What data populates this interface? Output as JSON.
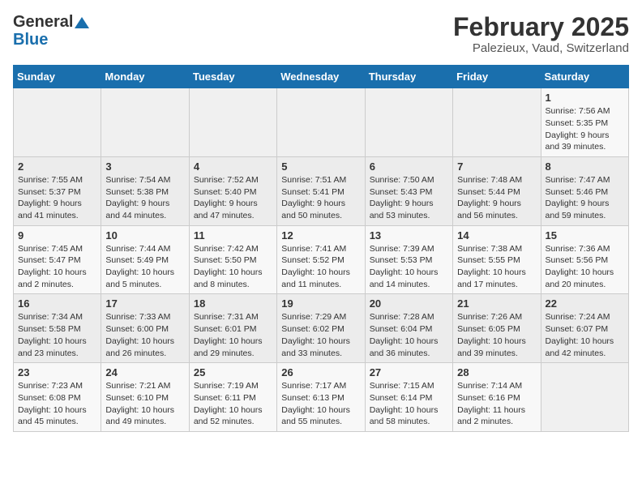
{
  "logo": {
    "line1": "General",
    "line2": "Blue"
  },
  "title": "February 2025",
  "location": "Palezieux, Vaud, Switzerland",
  "days_of_week": [
    "Sunday",
    "Monday",
    "Tuesday",
    "Wednesday",
    "Thursday",
    "Friday",
    "Saturday"
  ],
  "weeks": [
    [
      {
        "day": "",
        "info": ""
      },
      {
        "day": "",
        "info": ""
      },
      {
        "day": "",
        "info": ""
      },
      {
        "day": "",
        "info": ""
      },
      {
        "day": "",
        "info": ""
      },
      {
        "day": "",
        "info": ""
      },
      {
        "day": "1",
        "info": "Sunrise: 7:56 AM\nSunset: 5:35 PM\nDaylight: 9 hours and 39 minutes."
      }
    ],
    [
      {
        "day": "2",
        "info": "Sunrise: 7:55 AM\nSunset: 5:37 PM\nDaylight: 9 hours and 41 minutes."
      },
      {
        "day": "3",
        "info": "Sunrise: 7:54 AM\nSunset: 5:38 PM\nDaylight: 9 hours and 44 minutes."
      },
      {
        "day": "4",
        "info": "Sunrise: 7:52 AM\nSunset: 5:40 PM\nDaylight: 9 hours and 47 minutes."
      },
      {
        "day": "5",
        "info": "Sunrise: 7:51 AM\nSunset: 5:41 PM\nDaylight: 9 hours and 50 minutes."
      },
      {
        "day": "6",
        "info": "Sunrise: 7:50 AM\nSunset: 5:43 PM\nDaylight: 9 hours and 53 minutes."
      },
      {
        "day": "7",
        "info": "Sunrise: 7:48 AM\nSunset: 5:44 PM\nDaylight: 9 hours and 56 minutes."
      },
      {
        "day": "8",
        "info": "Sunrise: 7:47 AM\nSunset: 5:46 PM\nDaylight: 9 hours and 59 minutes."
      }
    ],
    [
      {
        "day": "9",
        "info": "Sunrise: 7:45 AM\nSunset: 5:47 PM\nDaylight: 10 hours and 2 minutes."
      },
      {
        "day": "10",
        "info": "Sunrise: 7:44 AM\nSunset: 5:49 PM\nDaylight: 10 hours and 5 minutes."
      },
      {
        "day": "11",
        "info": "Sunrise: 7:42 AM\nSunset: 5:50 PM\nDaylight: 10 hours and 8 minutes."
      },
      {
        "day": "12",
        "info": "Sunrise: 7:41 AM\nSunset: 5:52 PM\nDaylight: 10 hours and 11 minutes."
      },
      {
        "day": "13",
        "info": "Sunrise: 7:39 AM\nSunset: 5:53 PM\nDaylight: 10 hours and 14 minutes."
      },
      {
        "day": "14",
        "info": "Sunrise: 7:38 AM\nSunset: 5:55 PM\nDaylight: 10 hours and 17 minutes."
      },
      {
        "day": "15",
        "info": "Sunrise: 7:36 AM\nSunset: 5:56 PM\nDaylight: 10 hours and 20 minutes."
      }
    ],
    [
      {
        "day": "16",
        "info": "Sunrise: 7:34 AM\nSunset: 5:58 PM\nDaylight: 10 hours and 23 minutes."
      },
      {
        "day": "17",
        "info": "Sunrise: 7:33 AM\nSunset: 6:00 PM\nDaylight: 10 hours and 26 minutes."
      },
      {
        "day": "18",
        "info": "Sunrise: 7:31 AM\nSunset: 6:01 PM\nDaylight: 10 hours and 29 minutes."
      },
      {
        "day": "19",
        "info": "Sunrise: 7:29 AM\nSunset: 6:02 PM\nDaylight: 10 hours and 33 minutes."
      },
      {
        "day": "20",
        "info": "Sunrise: 7:28 AM\nSunset: 6:04 PM\nDaylight: 10 hours and 36 minutes."
      },
      {
        "day": "21",
        "info": "Sunrise: 7:26 AM\nSunset: 6:05 PM\nDaylight: 10 hours and 39 minutes."
      },
      {
        "day": "22",
        "info": "Sunrise: 7:24 AM\nSunset: 6:07 PM\nDaylight: 10 hours and 42 minutes."
      }
    ],
    [
      {
        "day": "23",
        "info": "Sunrise: 7:23 AM\nSunset: 6:08 PM\nDaylight: 10 hours and 45 minutes."
      },
      {
        "day": "24",
        "info": "Sunrise: 7:21 AM\nSunset: 6:10 PM\nDaylight: 10 hours and 49 minutes."
      },
      {
        "day": "25",
        "info": "Sunrise: 7:19 AM\nSunset: 6:11 PM\nDaylight: 10 hours and 52 minutes."
      },
      {
        "day": "26",
        "info": "Sunrise: 7:17 AM\nSunset: 6:13 PM\nDaylight: 10 hours and 55 minutes."
      },
      {
        "day": "27",
        "info": "Sunrise: 7:15 AM\nSunset: 6:14 PM\nDaylight: 10 hours and 58 minutes."
      },
      {
        "day": "28",
        "info": "Sunrise: 7:14 AM\nSunset: 6:16 PM\nDaylight: 11 hours and 2 minutes."
      },
      {
        "day": "",
        "info": ""
      }
    ]
  ]
}
